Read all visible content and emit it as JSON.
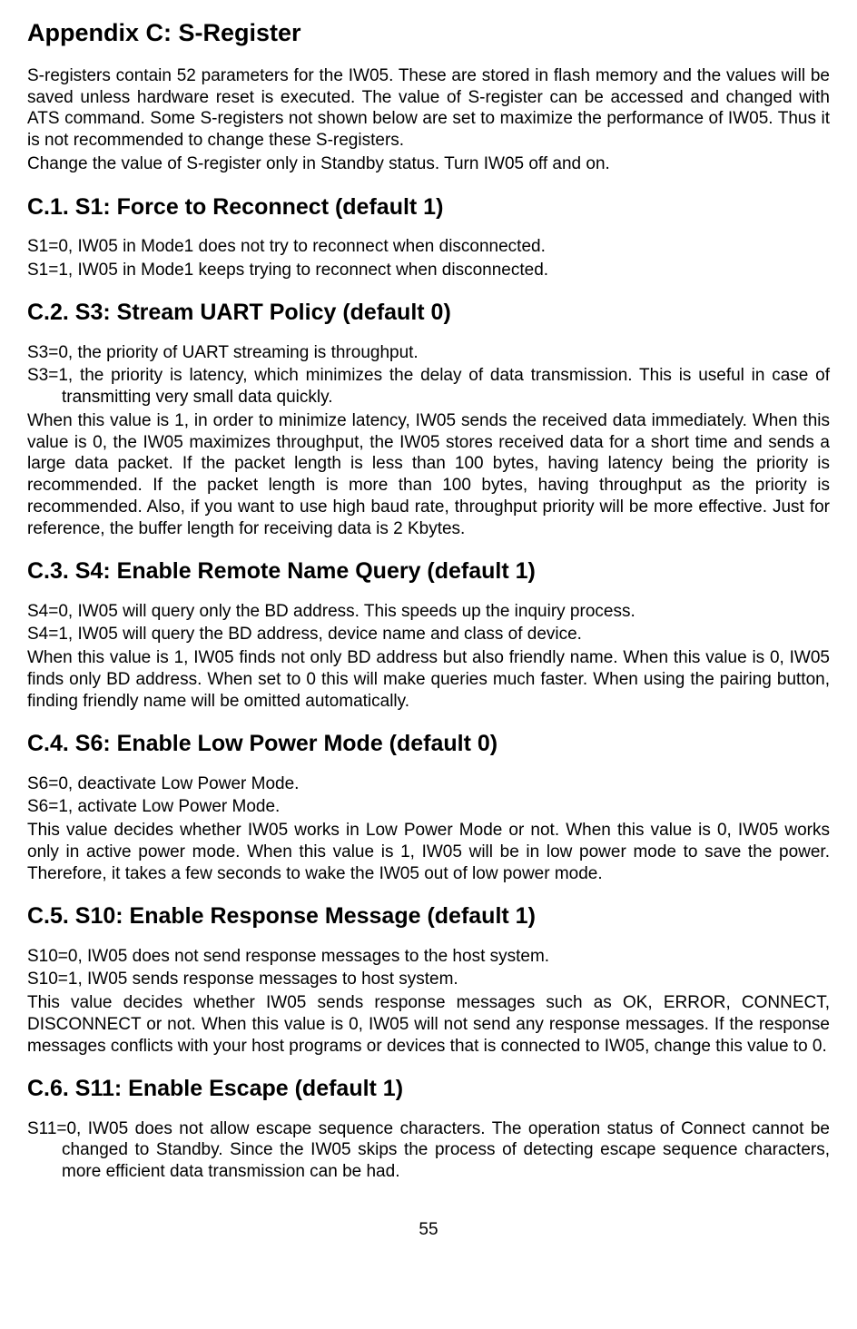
{
  "title": "Appendix C: S-Register",
  "intro_p1": "S-registers contain 52 parameters for the IW05. These are stored in flash memory and the values will be saved unless hardware reset is executed. The value of S-register can be accessed and changed with ATS command. Some S-registers not shown below are set to maximize the performance of IW05. Thus it is not recommended to change these S-registers.",
  "intro_p2": "Change the value of S-register only in Standby status. Turn IW05 off and on.",
  "sections": {
    "c1": {
      "heading": "C.1. S1: Force to Reconnect (default 1)",
      "line1": "S1=0, IW05 in Mode1 does not try to reconnect when disconnected.",
      "line2": "S1=1, IW05 in Mode1 keeps trying to reconnect when disconnected."
    },
    "c2": {
      "heading": "C.2. S3: Stream UART Policy (default 0)",
      "line1": "S3=0, the priority of UART streaming is throughput.",
      "line2": "S3=1, the priority is latency, which minimizes the delay of data transmission. This is useful in case of transmitting very small data quickly.",
      "para": "When this value is 1, in order to minimize latency, IW05 sends the received data immediately. When this value is 0, the IW05 maximizes throughput, the IW05 stores received data for a short time and sends a large data packet. If the packet length is less than 100 bytes, having latency being the priority is recommended. If the packet length is more than 100 bytes, having throughput as the priority is recommended. Also, if you want to use high baud rate, throughput priority will be more effective. Just for reference, the buffer length for receiving data is 2 Kbytes."
    },
    "c3": {
      "heading": "C.3. S4: Enable Remote Name Query (default 1)",
      "line1": "S4=0, IW05 will query only the BD address. This speeds up the inquiry process.",
      "line2": "S4=1, IW05 will query the BD address, device name and class of device.",
      "para": "When this value is 1, IW05 finds not only BD address but also friendly name. When this value is 0, IW05 finds only BD address. When set to 0 this will make queries much faster. When using the pairing button, finding friendly name will be omitted automatically."
    },
    "c4": {
      "heading": "C.4. S6: Enable Low Power Mode (default 0)",
      "line1": "S6=0, deactivate Low Power Mode.",
      "line2": "S6=1, activate Low Power Mode.",
      "para": "This value decides whether IW05 works in Low Power Mode or not. When this value is 0, IW05 works only in active power mode. When this value is 1, IW05 will be in low power mode to save the power. Therefore, it takes a few seconds to wake the IW05 out of low power mode."
    },
    "c5": {
      "heading": "C.5. S10: Enable Response Message (default 1)",
      "line1": "S10=0, IW05 does not send response messages to the host system.",
      "line2": "S10=1, IW05 sends response messages to host system.",
      "para": "This value decides whether IW05 sends response messages such as OK, ERROR, CONNECT, DISCONNECT or not. When this value is 0, IW05 will not send any response messages. If the response messages conflicts with your host programs or devices that is connected to IW05, change this value to 0."
    },
    "c6": {
      "heading": "C.6. S11: Enable Escape (default 1)",
      "line1": "S11=0, IW05 does not allow escape sequence characters. The operation status of Connect cannot be changed to Standby. Since the IW05 skips the process of detecting escape sequence characters, more efficient data transmission can be had."
    }
  },
  "page_number": "55"
}
